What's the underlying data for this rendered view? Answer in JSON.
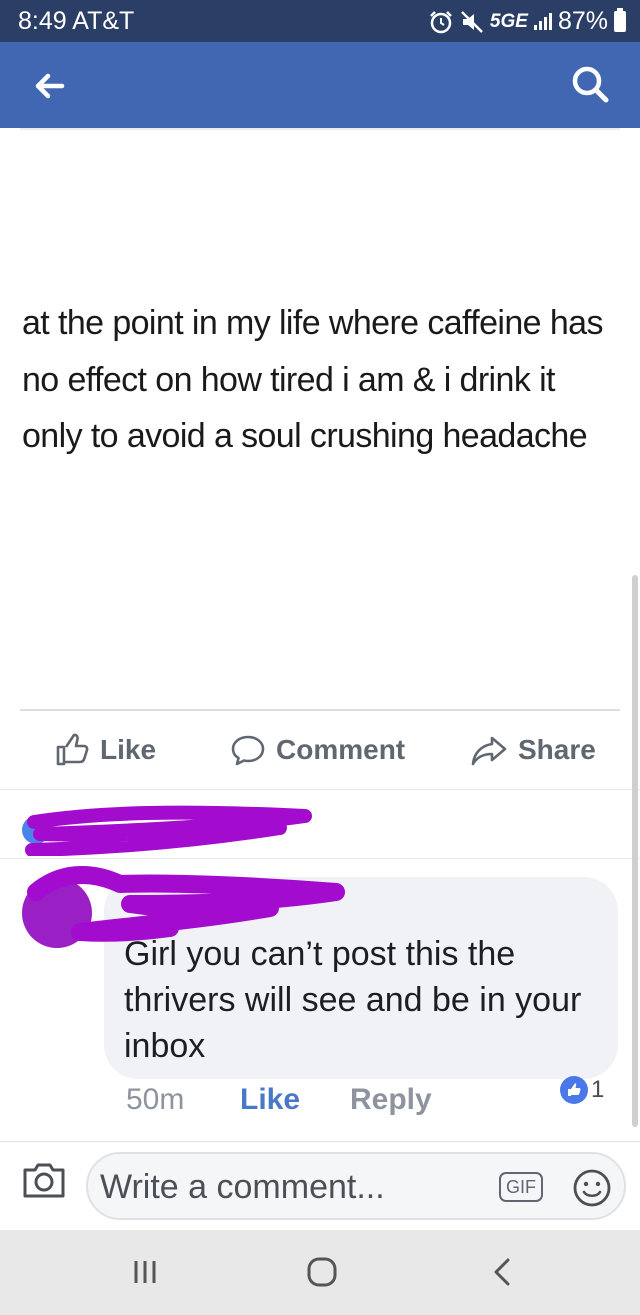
{
  "status_bar": {
    "time": "8:49",
    "carrier": "AT&T",
    "network": "5GE",
    "battery": "87%",
    "icons": [
      "alarm-icon",
      "mute-icon",
      "signal-icon",
      "battery-icon"
    ]
  },
  "header": {
    "back_icon": "arrow-left-icon",
    "search_icon": "search-icon",
    "background_color": "#4267b2"
  },
  "post": {
    "text": "at the point in my life where caffeine has no effect on how tired i am & i drink it only to avoid a soul crushing headache"
  },
  "actions": {
    "like": "Like",
    "comment": "Comment",
    "share": "Share"
  },
  "comment": {
    "text": "Girl you can’t post this the thrivers will see and be in your inbox",
    "time": "50m",
    "like": "Like",
    "reply": "Reply",
    "reaction_count": "1"
  },
  "composer": {
    "placeholder": "Write a comment...",
    "gif_label": "GIF"
  },
  "colors": {
    "brand_blue": "#4267b2",
    "status_bar": "#2b3f66",
    "redaction_purple": "#a30ccf"
  }
}
